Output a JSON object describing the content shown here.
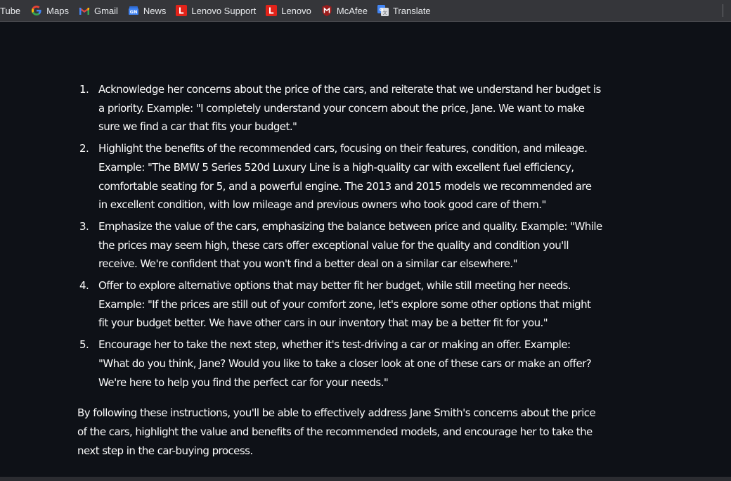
{
  "bookmarks": {
    "items": [
      {
        "label": "Tube",
        "icon": "youtube-icon"
      },
      {
        "label": "Maps",
        "icon": "google-icon"
      },
      {
        "label": "Gmail",
        "icon": "gmail-icon"
      },
      {
        "label": "News",
        "icon": "news-icon"
      },
      {
        "label": "Lenovo Support",
        "icon": "lenovo-icon"
      },
      {
        "label": "Lenovo",
        "icon": "lenovo-icon"
      },
      {
        "label": "McAfee",
        "icon": "mcafee-icon"
      },
      {
        "label": "Translate",
        "icon": "translate-icon"
      }
    ]
  },
  "colors": {
    "page_background": "#0e1117",
    "toolbar_background": "#35363a",
    "text": "#fafafa",
    "lenovo_red": "#e2231a",
    "mcafee_red": "#c01818"
  },
  "answer": {
    "steps": [
      {
        "number": "1.",
        "text": "Acknowledge her concerns about the price of the cars, and reiterate that we understand her budget is a priority. Example: \"I completely understand your concern about the price, Jane. We want to make sure we find a car that fits your budget.\""
      },
      {
        "number": "2.",
        "text": "Highlight the benefits of the recommended cars, focusing on their features, condition, and mileage. Example: \"The BMW 5 Series 520d Luxury Line is a high-quality car with excellent fuel efficiency, comfortable seating for 5, and a powerful engine. The 2013 and 2015 models we recommended are in excellent condition, with low mileage and previous owners who took good care of them.\""
      },
      {
        "number": "3.",
        "text": "Emphasize the value of the cars, emphasizing the balance between price and quality. Example: \"While the prices may seem high, these cars offer exceptional value for the quality and condition you'll receive. We're confident that you won't find a better deal on a similar car elsewhere.\""
      },
      {
        "number": "4.",
        "text": "Offer to explore alternative options that may better fit her budget, while still meeting her needs. Example: \"If the prices are still out of your comfort zone, let's explore some other options that might fit your budget better. We have other cars in our inventory that may be a better fit for you.\""
      },
      {
        "number": "5.",
        "text": "Encourage her to take the next step, whether it's test-driving a car or making an offer. Example: \"What do you think, Jane? Would you like to take a closer look at one of these cars or make an offer? We're here to help you find the perfect car for your needs.\""
      }
    ],
    "summary": "By following these instructions, you'll be able to effectively address Jane Smith's concerns about the price of the cars, highlight the value and benefits of the recommended models, and encourage her to take the next step in the car-buying process."
  }
}
